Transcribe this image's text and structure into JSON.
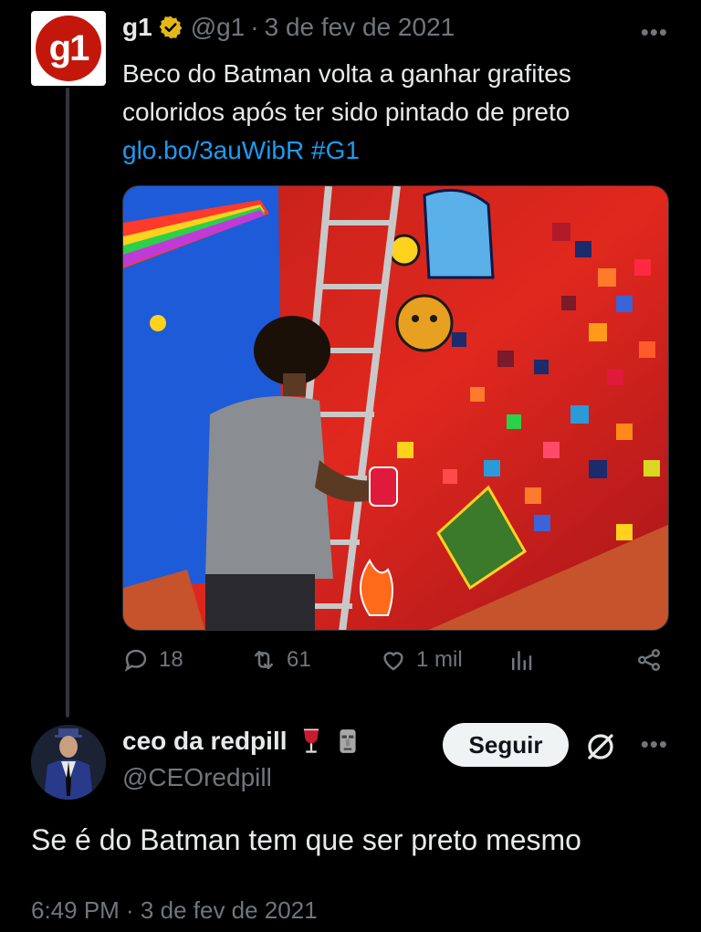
{
  "tweet": {
    "author_name": "g1",
    "handle": "@g1",
    "separator": "·",
    "date": "3 de fev de 2021",
    "avatar_text": "g1",
    "text": "Beco do Batman volta a ganhar grafites coloridos após ter sido pintado de preto",
    "link_text": "glo.bo/3auWibR #G1",
    "more_label": "•••",
    "stats": {
      "replies": "18",
      "retweets": "61",
      "likes": "1 mil"
    }
  },
  "reply": {
    "author_name": "ceo da redpill",
    "handle": "@CEOredpill",
    "follow_label": "Seguir",
    "more_label": "•••",
    "text": "Se é do Batman tem que ser preto mesmo",
    "timestamp": "6:49 PM · 3 de fev de 2021"
  },
  "icons": {
    "reply": "reply-icon",
    "retweet": "retweet-icon",
    "like": "heart-icon",
    "views": "analytics-icon",
    "share": "share-icon",
    "verified": "verified-badge-icon"
  },
  "colors": {
    "background": "#000000",
    "text": "#e7e9ea",
    "muted": "#71767b",
    "link": "#1d9bf0",
    "verified_gold": "#e2b719",
    "g1_red": "#c4170c"
  }
}
